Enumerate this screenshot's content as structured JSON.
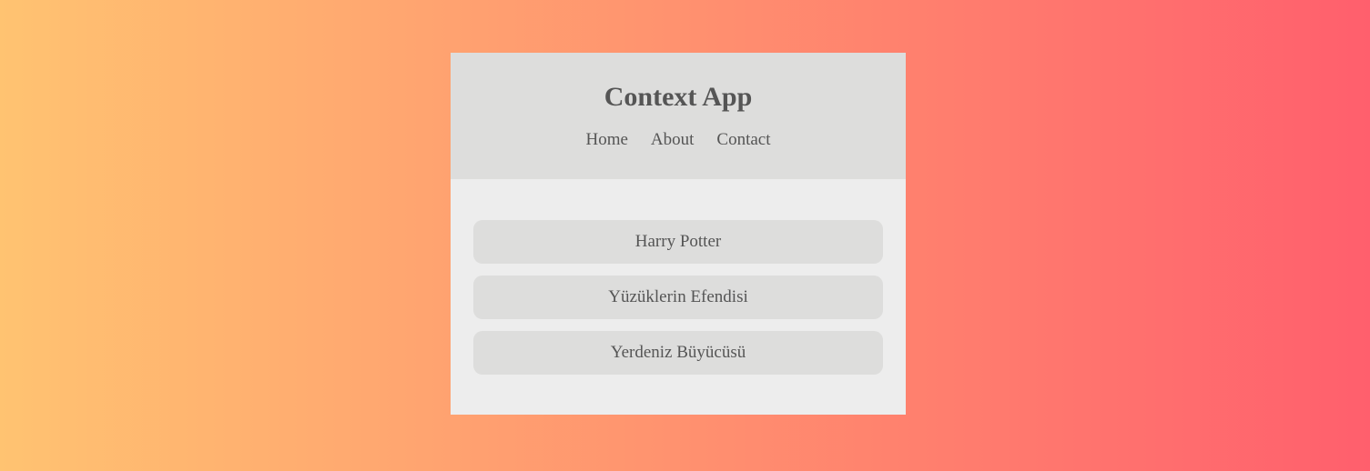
{
  "header": {
    "title": "Context App",
    "nav": [
      "Home",
      "About",
      "Contact"
    ]
  },
  "books": [
    "Harry Potter",
    "Yüzüklerin Efendisi",
    "Yerdeniz Büyücüsü"
  ],
  "colors": {
    "gradient_start": "#ffc371",
    "gradient_end": "#ff5f6d",
    "header_bg": "#dddddc",
    "content_bg": "#ededed",
    "text": "#555555"
  }
}
